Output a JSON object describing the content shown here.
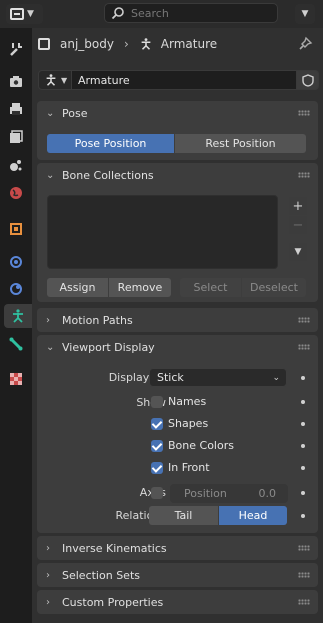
{
  "search": {
    "placeholder": "Search"
  },
  "breadcrumb": {
    "object": "anj_body",
    "data": "Armature"
  },
  "datablock": {
    "name": "Armature"
  },
  "sections": {
    "pose": {
      "title": "Pose",
      "pose_position": "Pose Position",
      "rest_position": "Rest Position",
      "active": "Pose Position"
    },
    "bone_collections": {
      "title": "Bone Collections",
      "add": "+",
      "remove": "−",
      "assign": "Assign",
      "remove_btn": "Remove",
      "select": "Select",
      "deselect": "Deselect"
    },
    "motion_paths": {
      "title": "Motion Paths"
    },
    "viewport_display": {
      "title": "Viewport Display",
      "display_as_label": "Display As",
      "display_as_value": "Stick",
      "show_label": "Show",
      "names": "Names",
      "shapes": "Shapes",
      "bone_colors": "Bone Colors",
      "in_front": "In Front",
      "axes_label": "Axes",
      "position_label": "Position",
      "position_value": "0.0",
      "relations_label": "Relations",
      "tail": "Tail",
      "head": "Head",
      "relations_active": "Head",
      "names_checked": false,
      "shapes_checked": true,
      "bone_colors_checked": true,
      "in_front_checked": true,
      "axes_checked": false
    },
    "inverse_kinematics": {
      "title": "Inverse Kinematics"
    },
    "selection_sets": {
      "title": "Selection Sets"
    },
    "custom_properties": {
      "title": "Custom Properties"
    }
  },
  "tabs": [
    "tool-tab",
    "render-tab",
    "output-tab",
    "view-layer-tab",
    "scene-tab",
    "world-tab",
    "object-tab",
    "modifiers-tab",
    "physics-tab",
    "armature-data-tab",
    "bone-tab",
    "texture-tab"
  ],
  "colors": {
    "accent": "#4772b3",
    "panel": "#303030",
    "section": "#3d3d3d"
  }
}
